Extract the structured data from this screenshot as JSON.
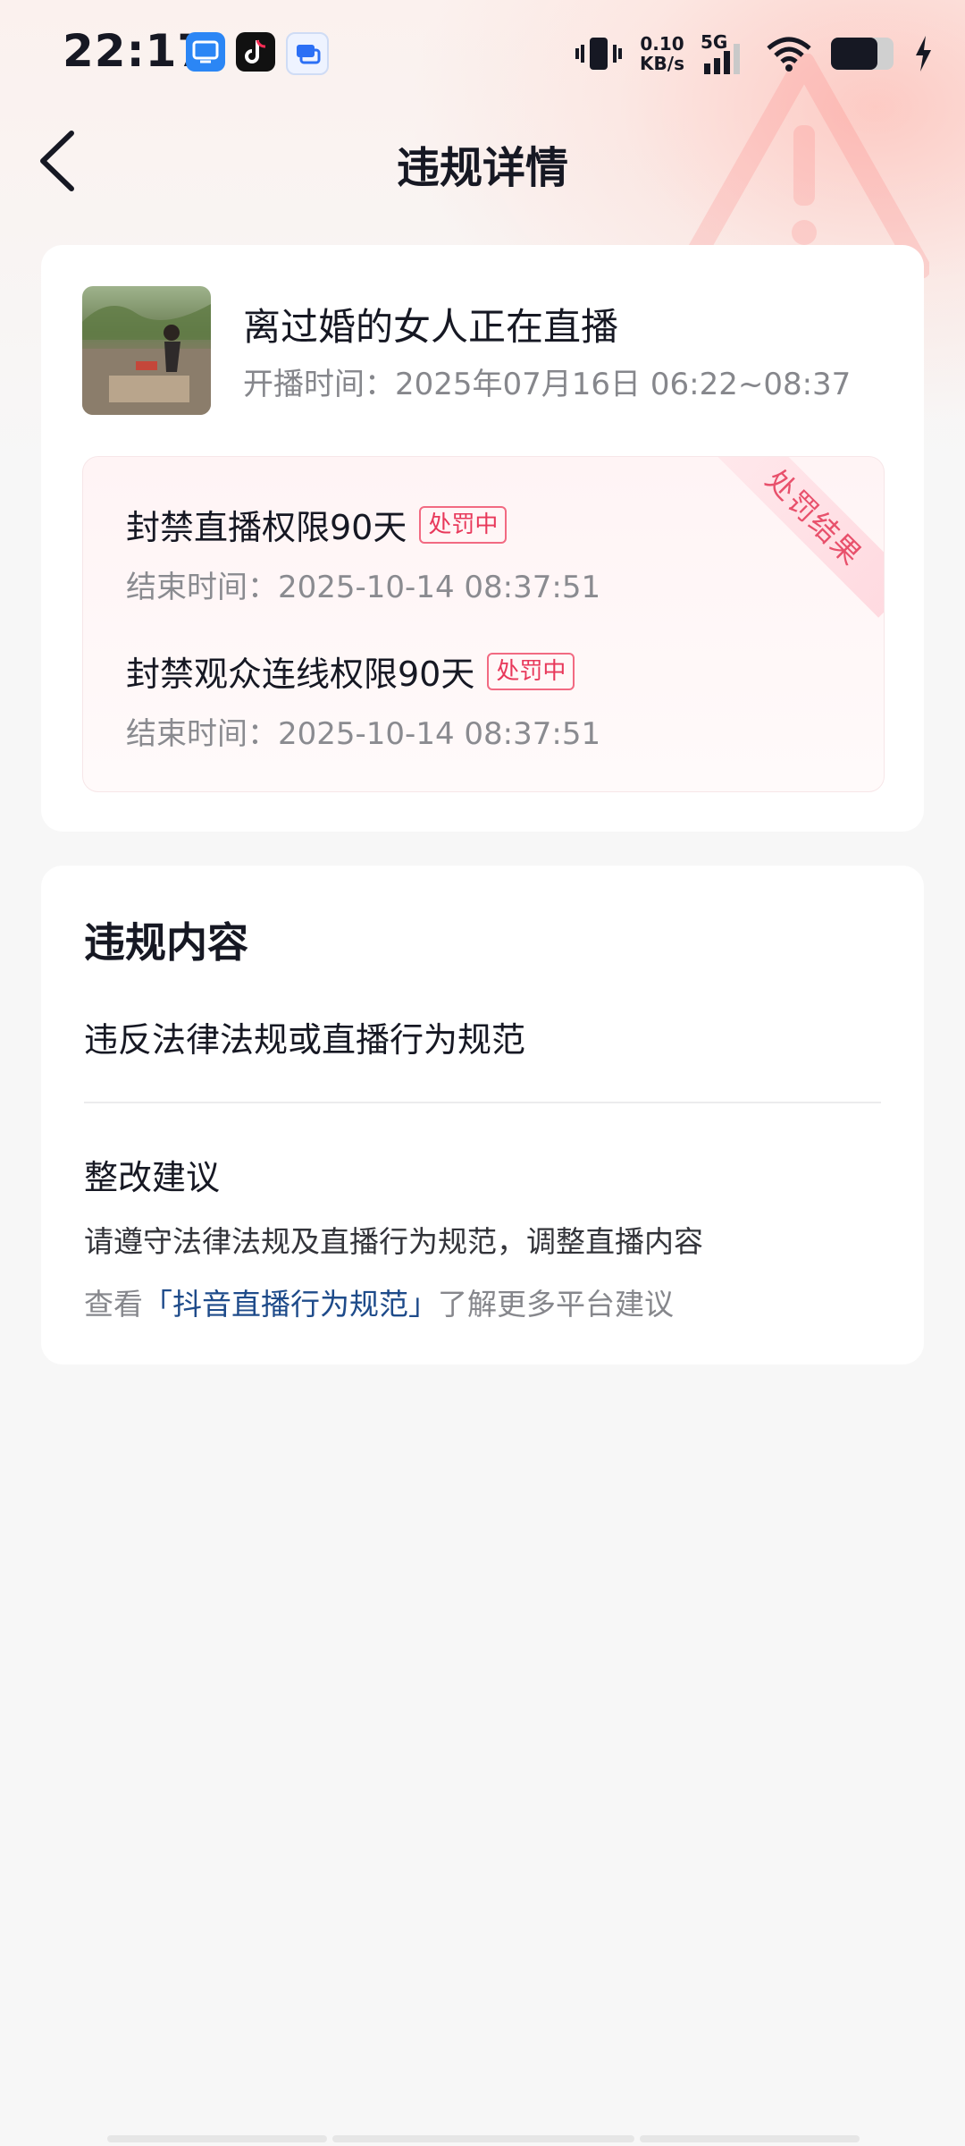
{
  "status_bar": {
    "time": "22:17",
    "net_speed": "0.10",
    "net_unit": "KB/s",
    "network_type": "5G"
  },
  "header": {
    "title": "违规详情"
  },
  "stream": {
    "title": "离过婚的女人正在直播",
    "time_label": "开播时间：",
    "time_value": "2025年07月16日 06:22~08:37"
  },
  "penalty": {
    "ribbon": "处罚结果",
    "items": [
      {
        "title": "封禁直播权限90天",
        "status": "处罚中",
        "end_label": "结束时间：",
        "end_value": "2025-10-14 08:37:51"
      },
      {
        "title": "封禁观众连线权限90天",
        "status": "处罚中",
        "end_label": "结束时间：",
        "end_value": "2025-10-14 08:37:51"
      }
    ]
  },
  "violation": {
    "section_title": "违规内容",
    "content": "违反法律法规或直播行为规范",
    "suggestion_title": "整改建议",
    "suggestion_text": "请遵守法律法规及直播行为规范，调整直播内容",
    "guide_prefix": "查看",
    "guide_link": "「抖音直播行为规范」",
    "guide_suffix": "了解更多平台建议"
  },
  "colors": {
    "accent_red": "#e8385a",
    "link_blue": "#1e4b8a"
  }
}
